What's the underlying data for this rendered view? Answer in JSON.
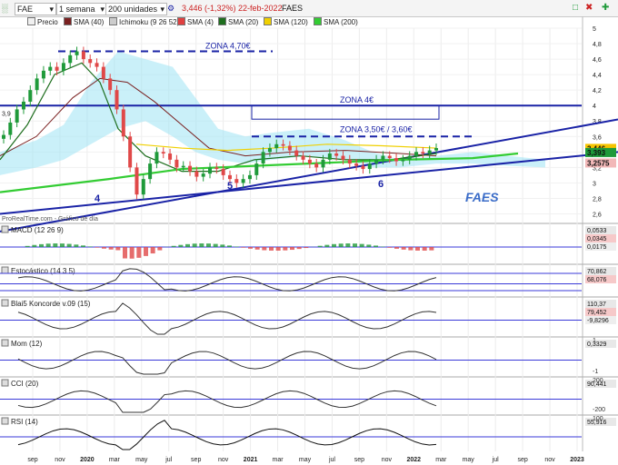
{
  "toolbar": {
    "symbol": "FAE",
    "period": "1 semana",
    "units": "200 unidades",
    "price_text": "3,446 (-1,32%) 22-feb-2022",
    "name": "FAES"
  },
  "legend": [
    {
      "label": "Precio",
      "color": "#f0f0f0"
    },
    {
      "label": "SMA (40)",
      "color": "#7a2020"
    },
    {
      "label": "Ichimoku (9 26 52)",
      "color": "#cccccc"
    },
    {
      "label": "SMA (4)",
      "color": "#e04040"
    },
    {
      "label": "SMA (20)",
      "color": "#1e6e1e"
    },
    {
      "label": "SMA (120)",
      "color": "#f0d000"
    },
    {
      "label": "SMA (200)",
      "color": "#33cc33"
    }
  ],
  "colors": {
    "down": "#e04848",
    "up": "#1f9a3a",
    "trend": "#1a23a6",
    "label_blue": "#1a23a6"
  },
  "watermark": "ProRealTime.com - Gráfico de día",
  "brand_label": "FAES",
  "wave_labels": [
    "4",
    "5",
    "6"
  ],
  "zones": [
    {
      "label": "ZONA 4,70€",
      "level": 4.7
    },
    {
      "label": "ZONA 4€",
      "level": 4.0
    },
    {
      "label": "ZONA 3,50€ / 3,60€",
      "level": 3.6
    }
  ],
  "chart_data": {
    "type": "candlestick",
    "main": {
      "y_axis_ticks": [
        "5",
        "4,8",
        "4,6",
        "4,4",
        "4,2",
        "4",
        "3,8",
        "3,6",
        "3,4",
        "3,2",
        "3",
        "2,8",
        "2,6"
      ],
      "ylim": [
        2.5,
        5.0
      ],
      "last_price": "3,446",
      "right_labels": [
        {
          "text": "3,446",
          "color": "#f5c400"
        },
        {
          "text": "3,393",
          "color": "#1f9a3a"
        },
        {
          "text": "3,2575",
          "color": "#f2b8b8"
        }
      ],
      "left_label": "3,9",
      "close_series": [
        3.62,
        3.78,
        3.95,
        4.05,
        4.2,
        4.35,
        4.45,
        4.5,
        4.45,
        4.55,
        4.65,
        4.7,
        4.6,
        4.55,
        4.5,
        4.35,
        4.2,
        3.95,
        3.6,
        3.2,
        2.85,
        3.05,
        3.25,
        3.4,
        3.38,
        3.3,
        3.2,
        3.22,
        3.15,
        3.08,
        3.12,
        3.2,
        3.18,
        3.1,
        3.05,
        3.0,
        3.05,
        3.1,
        3.25,
        3.4,
        3.45,
        3.5,
        3.48,
        3.42,
        3.35,
        3.3,
        3.25,
        3.2,
        3.3,
        3.38,
        3.35,
        3.3,
        3.25,
        3.22,
        3.18,
        3.25,
        3.3,
        3.35,
        3.32,
        3.28,
        3.3,
        3.35,
        3.4,
        3.38,
        3.42,
        3.45
      ],
      "sma_200": [
        3.0,
        3.02,
        3.04,
        3.06,
        3.08,
        3.1,
        3.12,
        3.14,
        3.16,
        3.18,
        3.2,
        3.22,
        3.25
      ],
      "trend_lower": {
        "from": 2.9,
        "to": 3.62
      },
      "trend_upper": {
        "from": 2.6,
        "to": 3.4
      }
    },
    "indicators": [
      {
        "name": "MACD (12 26 9)",
        "values": [
          "0,0533",
          "0,0345",
          "0,0175"
        ]
      },
      {
        "name": "Estocástico (14 3 5)",
        "values": [
          "70,862",
          "68,076"
        ]
      },
      {
        "name": "Blai5 Koncorde v.09 (15)",
        "values": [
          "110,37",
          "79,452",
          "-9,8296"
        ]
      },
      {
        "name": "Mom (12)",
        "values": [
          "0,3329"
        ],
        "ticks": [
          "1",
          "-1"
        ]
      },
      {
        "name": "CCI (20)",
        "values": [
          "90,441"
        ],
        "ticks": [
          "200",
          "-200"
        ]
      },
      {
        "name": "RSI (14)",
        "values": [
          "55,916"
        ],
        "ticks": [
          "100"
        ]
      }
    ],
    "x_ticks": [
      "sep",
      "nov",
      "2020",
      "mar",
      "may",
      "jul",
      "sep",
      "nov",
      "2021",
      "mar",
      "may",
      "jul",
      "sep",
      "nov",
      "2022",
      "mar",
      "may",
      "jul",
      "sep",
      "nov",
      "2023"
    ]
  }
}
